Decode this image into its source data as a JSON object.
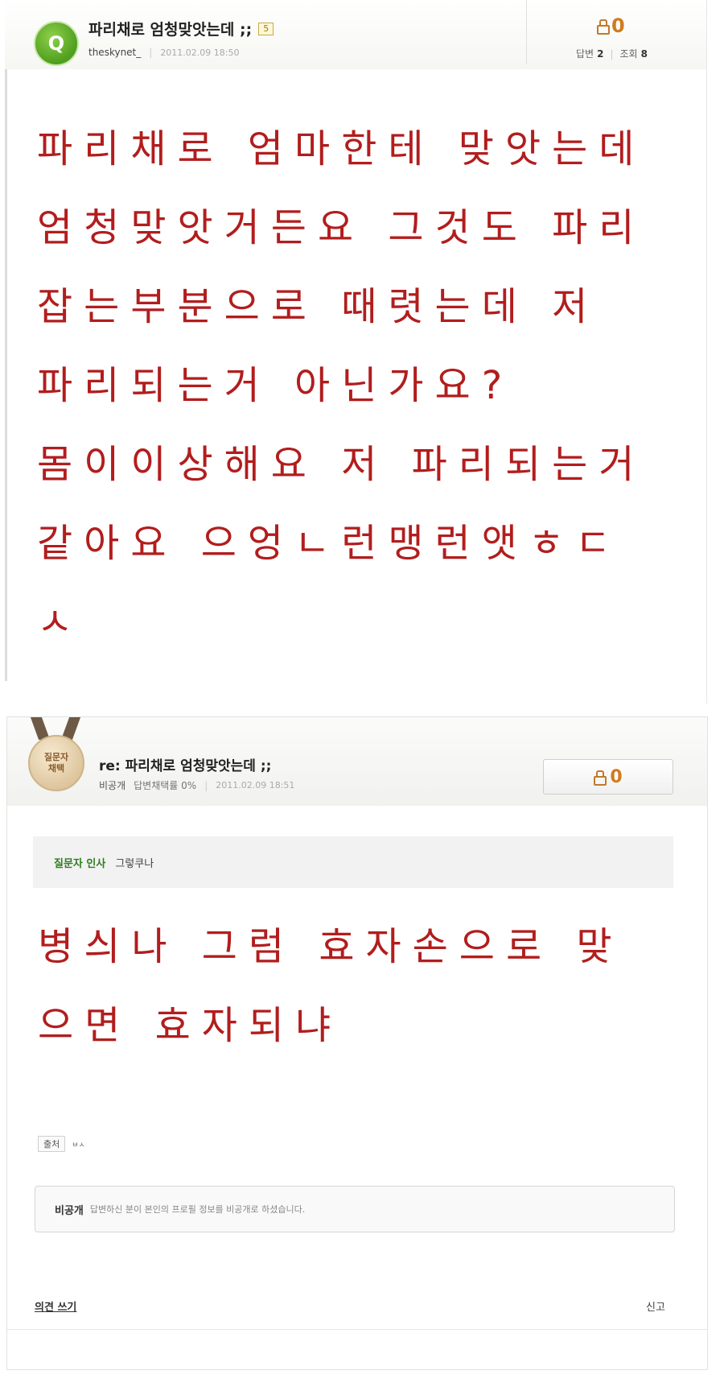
{
  "question": {
    "badge_letter": "Q",
    "title": "파리채로 엄청맞앗는데 ;;",
    "level": "5",
    "author": "theskynet_",
    "date": "2011.02.09 18:50",
    "recommend_count": "0",
    "answers_label": "답변",
    "answers_count": "2",
    "views_label": "조회",
    "views_count": "8",
    "body_lines": [
      "파리채로 엄마한테 맞앗는데",
      "엄청맞앗거든요 그것도 파리",
      "잡는부분으로 때렷는데 저",
      "파리되는거 아닌가요?",
      "몸이이상해요 저 파리되는거",
      "같아요 으엉ㄴ런맹런앳ㅎㄷ",
      "ㅅ"
    ]
  },
  "answer": {
    "medal_line1": "질문자",
    "medal_line2": "채택",
    "title": "re: 파리채로 엄청맞앗는데 ;;",
    "author": "비공개",
    "adopt_rate": "답변채택률 0%",
    "date": "2011.02.09 18:51",
    "recommend_count": "0",
    "greeting_label": "질문자 인사",
    "greeting_text": "그렇쿠나",
    "body_lines": [
      "병싀나 그럼 효자손으로 맞",
      "으면 효자되냐"
    ],
    "source_label": "출처",
    "source_value": "ㅂㅅ",
    "privacy_label": "비공개",
    "privacy_text": "답변하신 분이 본인의 프로필 정보를 비공개로 하셨습니다.",
    "comment_link": "의견 쓰기",
    "report_link": "신고"
  },
  "colors": {
    "body_text": "#b21d1d",
    "recommend": "#d07b1e",
    "greeting_label": "#2f7d1f"
  },
  "icons": {
    "recommend": "thumbs-up-icon",
    "question_badge": "question-badge-icon",
    "medal": "medal-icon"
  }
}
